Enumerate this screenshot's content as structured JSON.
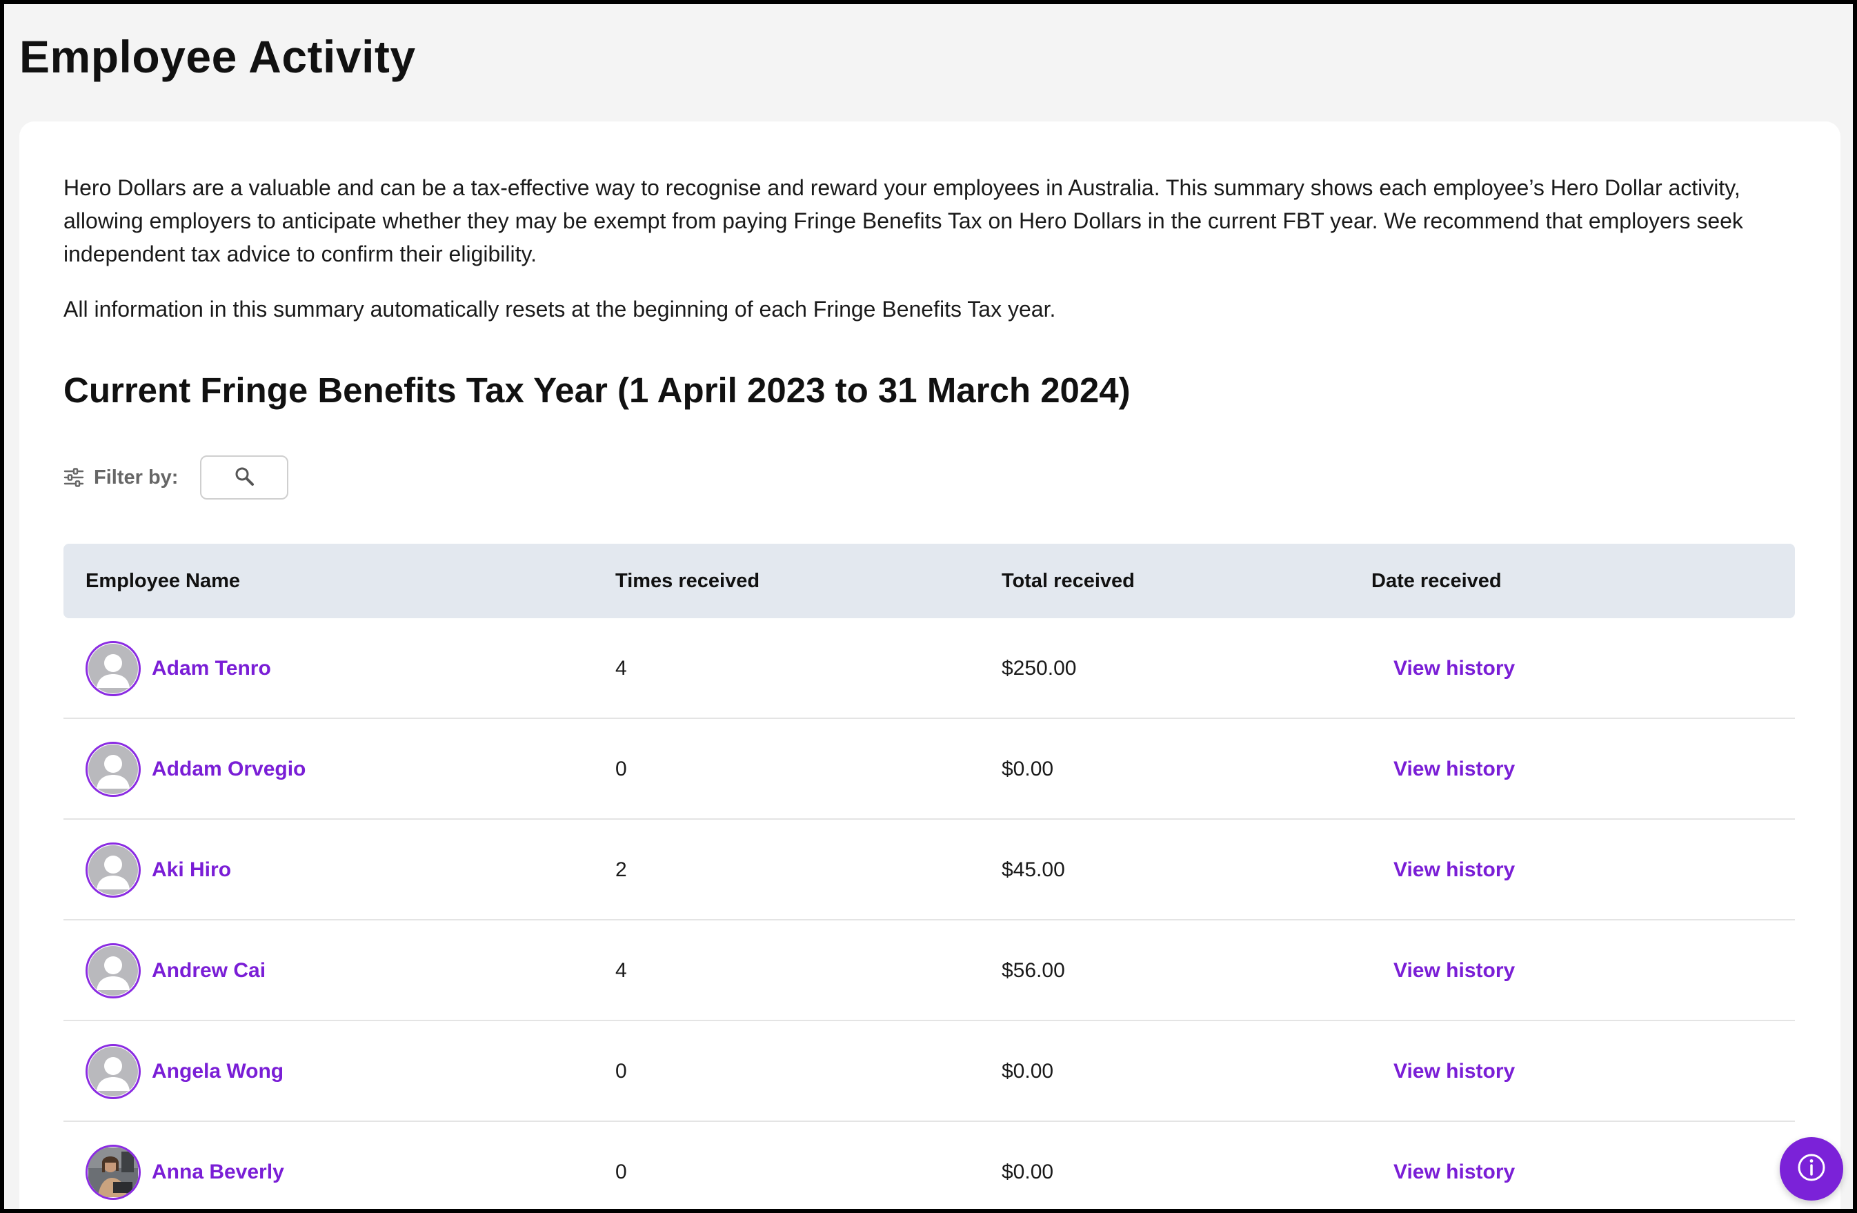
{
  "header": {
    "title": "Employee Activity"
  },
  "intro": {
    "paragraph1": "Hero Dollars are a valuable and can be a tax-effective way to recognise and reward your employees in Australia. This summary shows each employee’s Hero Dollar activity, allowing employers to anticipate whether they may be exempt from paying Fringe Benefits Tax on Hero Dollars in the current FBT year. We recommend that employers seek independent tax advice to confirm their eligibility.",
    "paragraph2": "All information in this summary automatically resets at the beginning of each Fringe Benefits Tax year."
  },
  "section": {
    "title": "Current Fringe Benefits Tax Year (1 April 2023 to 31 March 2024)"
  },
  "filter": {
    "label": "Filter by:",
    "icon": "sliders-icon",
    "search_icon": "search-icon",
    "search_placeholder": ""
  },
  "table": {
    "columns": {
      "name": "Employee Name",
      "times": "Times received",
      "total": "Total received",
      "date": "Date received"
    },
    "rows": [
      {
        "name": "Adam Tenro",
        "times": "4",
        "total": "$250.00",
        "action": "View history",
        "avatar": "default"
      },
      {
        "name": "Addam Orvegio",
        "times": "0",
        "total": "$0.00",
        "action": "View history",
        "avatar": "default"
      },
      {
        "name": "Aki Hiro",
        "times": "2",
        "total": "$45.00",
        "action": "View history",
        "avatar": "default"
      },
      {
        "name": "Andrew Cai",
        "times": "4",
        "total": "$56.00",
        "action": "View history",
        "avatar": "default"
      },
      {
        "name": "Angela Wong",
        "times": "0",
        "total": "$0.00",
        "action": "View history",
        "avatar": "default"
      },
      {
        "name": "Anna Beverly",
        "times": "0",
        "total": "$0.00",
        "action": "View history",
        "avatar": "photo"
      }
    ]
  },
  "fab": {
    "icon": "info-icon"
  },
  "colors": {
    "accent": "#7a1ed6",
    "header_bg": "#e3e8ef",
    "page_bg": "#f4f4f4"
  }
}
